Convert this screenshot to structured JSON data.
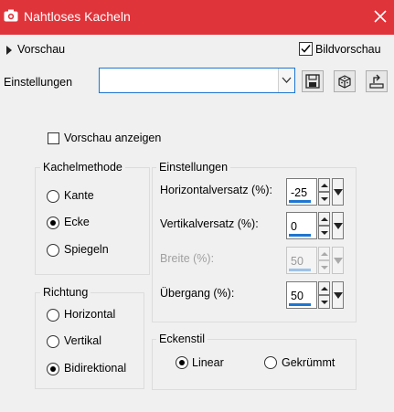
{
  "window": {
    "title": "Nahtloses Kacheln",
    "close_icon": "close-icon"
  },
  "toolbar": {
    "preview_label": "Vorschau",
    "image_preview_label": "Bildvorschau",
    "image_preview_checked": true,
    "settings_label": "Einstellungen",
    "settings_value": ""
  },
  "options": {
    "show_preview_label": "Vorschau anzeigen",
    "show_preview_checked": false
  },
  "tiling": {
    "legend": "Kachelmethode",
    "options": [
      "Kante",
      "Ecke",
      "Spiegeln"
    ],
    "selected": "Ecke"
  },
  "direction": {
    "legend": "Richtung",
    "options": [
      "Horizontal",
      "Vertikal",
      "Bidirektional"
    ],
    "selected": "Bidirektional"
  },
  "settings": {
    "legend": "Einstellungen",
    "fields": [
      {
        "label": "Horizontalversatz (%):",
        "value": "-25",
        "enabled": true
      },
      {
        "label": "Vertikalversatz (%):",
        "value": "0",
        "enabled": true
      },
      {
        "label": "Breite (%):",
        "value": "50",
        "enabled": false
      },
      {
        "label": "Übergang (%):",
        "value": "50",
        "enabled": true
      }
    ]
  },
  "corner": {
    "legend": "Eckenstil",
    "options": [
      "Linear",
      "Gekrümmt"
    ],
    "selected": "Linear"
  },
  "colors": {
    "titlebar": "#e0343b",
    "accent": "#1e76d0"
  }
}
